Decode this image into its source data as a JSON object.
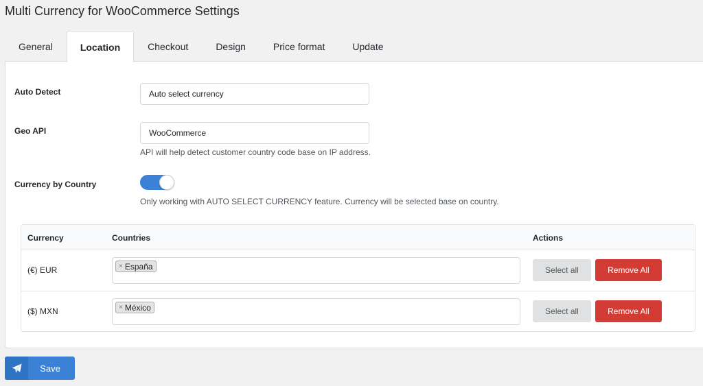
{
  "page": {
    "title": "Multi Currency for WooCommerce Settings"
  },
  "tabs": [
    {
      "label": "General",
      "active": false
    },
    {
      "label": "Location",
      "active": true
    },
    {
      "label": "Checkout",
      "active": false
    },
    {
      "label": "Design",
      "active": false
    },
    {
      "label": "Price format",
      "active": false
    },
    {
      "label": "Update",
      "active": false
    }
  ],
  "auto_detect": {
    "label": "Auto Detect",
    "value": "Auto select currency"
  },
  "geo_api": {
    "label": "Geo API",
    "value": "WooCommerce",
    "help": "API will help detect customer country code base on IP address."
  },
  "currency_by_country": {
    "label": "Currency by Country",
    "enabled": true,
    "help": "Only working with AUTO SELECT CURRENCY feature. Currency will be selected base on country."
  },
  "table": {
    "headers": {
      "currency": "Currency",
      "countries": "Countries",
      "actions": "Actions"
    },
    "rows": [
      {
        "currency": "(€) EUR",
        "countries": [
          "España"
        ],
        "select_all": "Select all",
        "remove_all": "Remove All"
      },
      {
        "currency": "($) MXN",
        "countries": [
          "México"
        ],
        "select_all": "Select all",
        "remove_all": "Remove All"
      }
    ]
  },
  "chip_remove_glyph": "×",
  "save": {
    "label": "Save",
    "icon": "paper-plane-icon"
  },
  "colors": {
    "accent": "#3b82d6",
    "danger": "#d33b35",
    "neutral_button": "#e0e1e2"
  }
}
